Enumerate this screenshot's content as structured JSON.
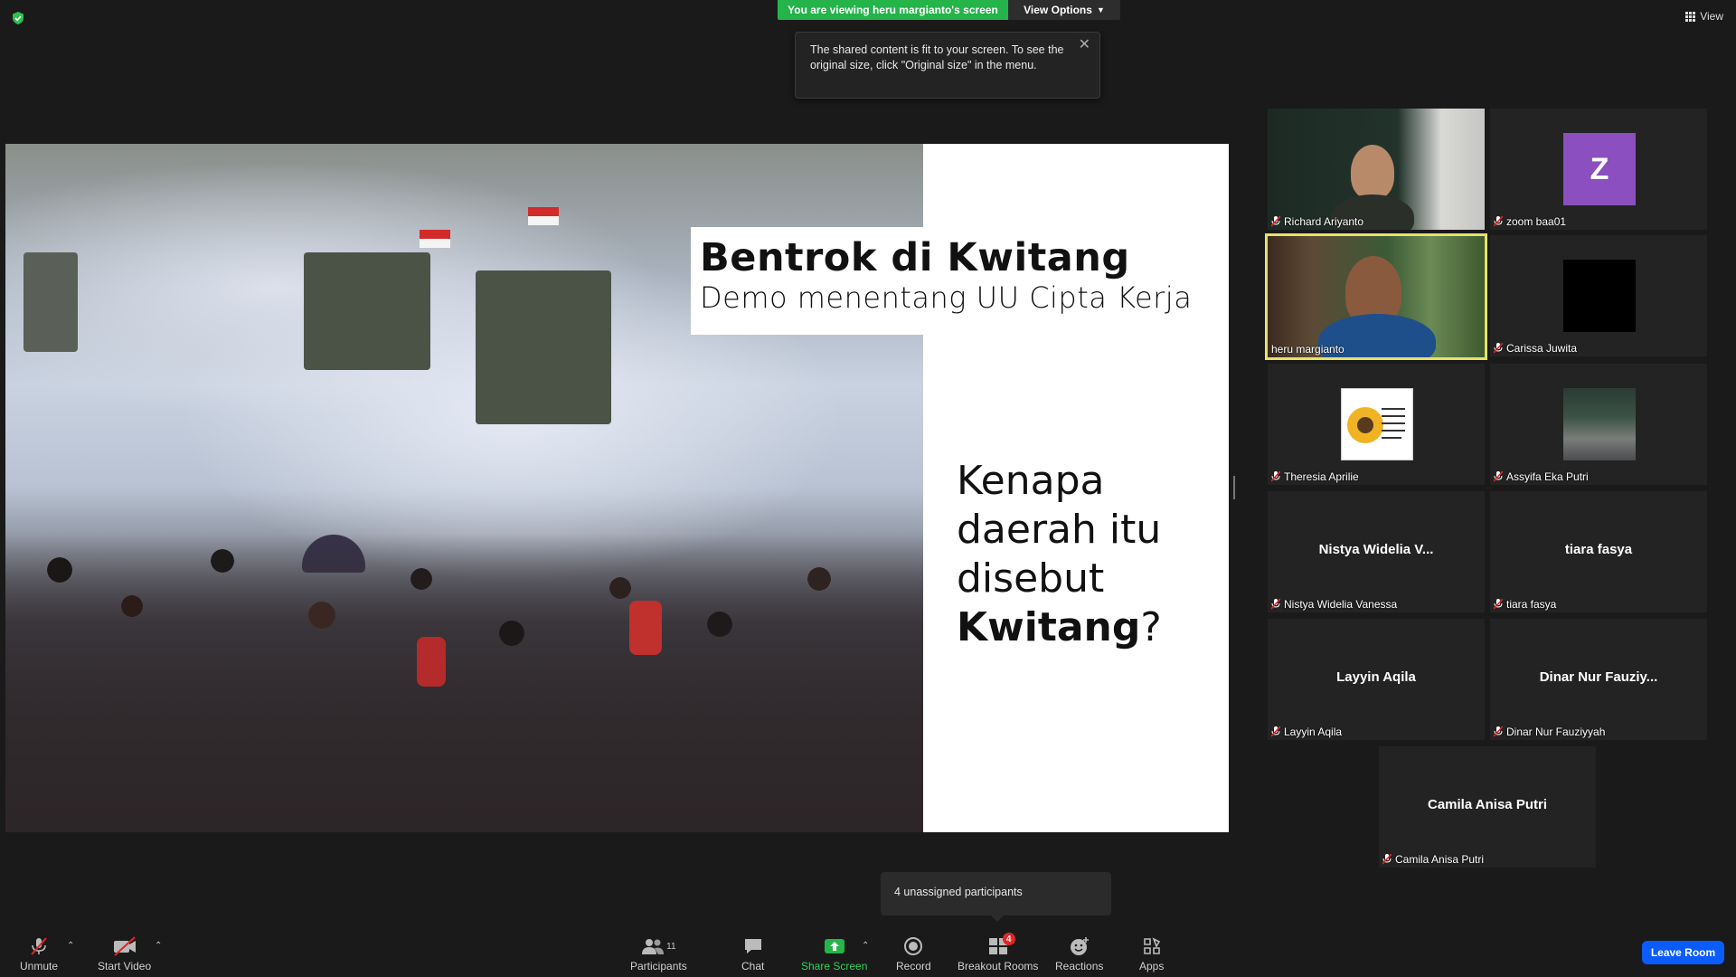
{
  "banner": {
    "viewing": "You are viewing heru margianto's screen",
    "view_options": "View Options"
  },
  "top_right": {
    "view_label": "View"
  },
  "tooltip": {
    "text": "The shared content is fit to your screen. To see the original size, click \"Original size\" in the menu."
  },
  "slide": {
    "title": "Bentrok di Kwitang",
    "subtitle": "Demo menentang UU Cipta Kerja",
    "question_line1": "Kenapa",
    "question_line2": "daerah itu",
    "question_line3": "disebut",
    "question_bold": "Kwitang",
    "question_end": "?"
  },
  "gallery": [
    {
      "name": "Richard Ariyanto",
      "type": "video",
      "muted": true
    },
    {
      "name": "zoom baa01",
      "type": "avatar",
      "avatar_letter": "Z",
      "muted": true
    },
    {
      "name": "heru margianto",
      "type": "video",
      "active": true,
      "muted": false
    },
    {
      "name": "Carissa Juwita",
      "type": "avatar",
      "muted": true
    },
    {
      "name": "Theresia Aprilie",
      "type": "avatar",
      "muted": true
    },
    {
      "name": "Assyifa Eka Putri",
      "type": "avatar",
      "muted": true
    },
    {
      "name": "Nistya Widelia Vanessa",
      "display": "Nistya Widelia V...",
      "type": "name",
      "muted": true
    },
    {
      "name": "tiara fasya",
      "display": "tiara fasya",
      "type": "name",
      "muted": true
    },
    {
      "name": "Layyin Aqila",
      "display": "Layyin Aqila",
      "type": "name",
      "muted": true
    },
    {
      "name": "Dinar Nur Fauziyyah",
      "display": "Dinar Nur Fauziy...",
      "type": "name",
      "muted": true
    },
    {
      "name": "Camila Anisa Putri",
      "display": "Camila Anisa Putri",
      "type": "name",
      "muted": true
    }
  ],
  "toolbar": {
    "unmute": "Unmute",
    "start_video": "Start Video",
    "participants": "Participants",
    "participants_count": "11",
    "chat": "Chat",
    "share_screen": "Share Screen",
    "record": "Record",
    "breakout_rooms": "Breakout Rooms",
    "breakout_badge": "4",
    "reactions": "Reactions",
    "apps": "Apps",
    "leave": "Leave Room"
  },
  "popover": {
    "unassigned": "4 unassigned participants"
  },
  "colors": {
    "share_green": "#24b44a",
    "active_border": "#e6e26a",
    "leave_blue": "#0b5cff",
    "avatar_purple": "#8b4fc0"
  }
}
